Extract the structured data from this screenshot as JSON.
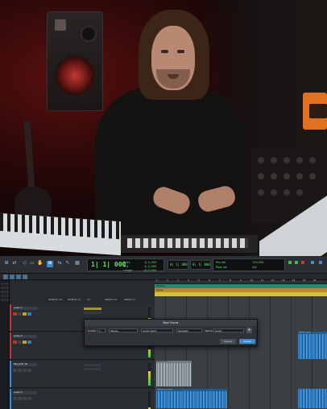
{
  "daw": {
    "counter_main": "1| 1| 000",
    "counter_sub": [
      "Start",
      "End",
      "Length"
    ],
    "counter_sub_r": [
      "1| 1| 000",
      "1| 1| 000",
      "0| 0| 000"
    ],
    "nudge": "0| 1| 000",
    "grid": "0| 1| 000",
    "tempo_labels": [
      "Pre-roll",
      "Post-roll"
    ],
    "tempo_values": [
      "120.000",
      "4/4"
    ],
    "tracks": [
      {
        "name": "Audio 1",
        "color": "#c43a35"
      },
      {
        "name": "Audio 2",
        "color": "#c43a35"
      },
      {
        "name": "Audio 3",
        "color": "#3a8ee0"
      },
      {
        "name": "MIX_RTR_TR",
        "color": "#3a8ee0"
      },
      {
        "name": "Audio 5",
        "color": "#3a8ee0"
      }
    ],
    "column_headers": [
      "INSERTS A-E",
      "INSERTS F-J",
      "I/O",
      "SENDS A-E",
      "SENDS F-J"
    ],
    "ruler_marks": [
      "1",
      "2",
      "3",
      "4",
      "5",
      "6",
      "7",
      "8",
      "9",
      "10",
      "11",
      "12",
      "13",
      "14",
      "15",
      "16"
    ],
    "ruler_green": "Markers",
    "ruler_orange": "Tempo",
    "clips": [
      {
        "name": "Audio 3_01"
      },
      {
        "name": "MIX_RTR_TR_01"
      },
      {
        "name": "Audio 5_01"
      }
    ]
  },
  "dialog": {
    "title": "New Tracks",
    "create_label": "Create",
    "count": "1",
    "width": "Stereo",
    "type": "Audio Track",
    "timebase": "Samples",
    "name_label": "Name:",
    "name_value": "Audio",
    "cancel": "Cancel",
    "create": "Create"
  }
}
